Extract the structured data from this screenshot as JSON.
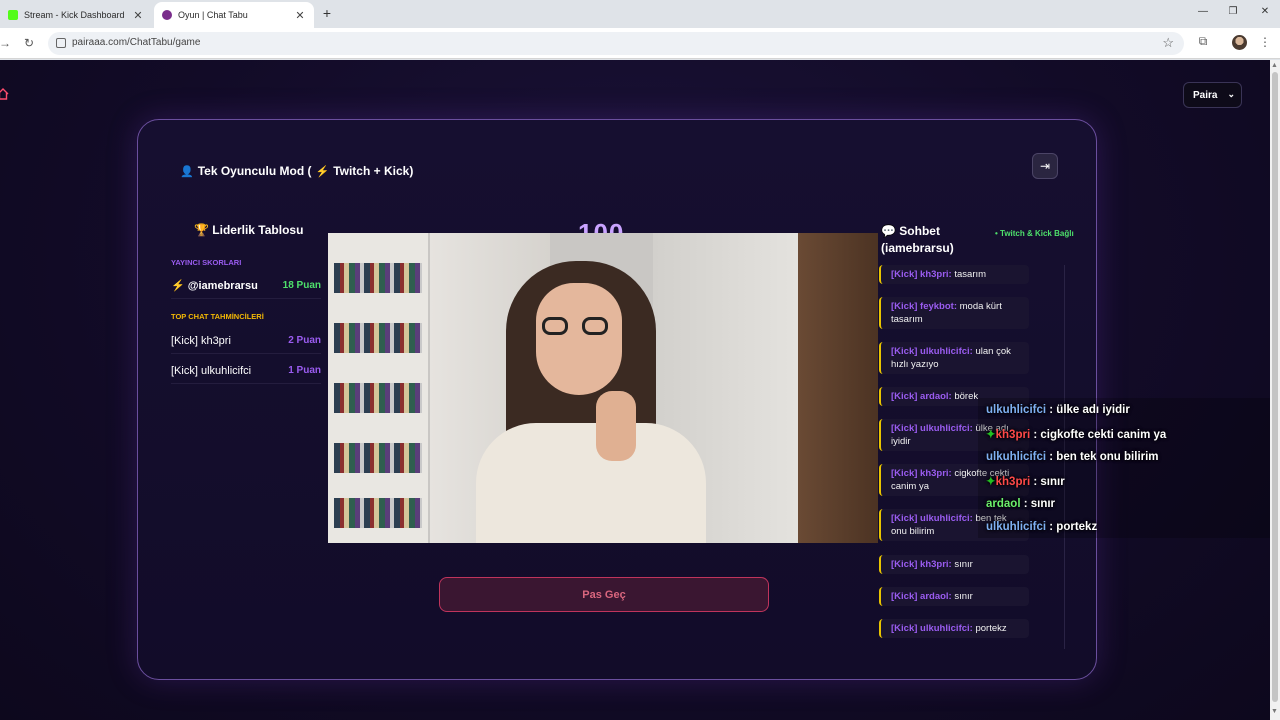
{
  "browser": {
    "tabs": [
      {
        "title": "Stream - Kick Dashboard",
        "favicon_color": "#53fc18"
      },
      {
        "title": "Oyun | Chat Tabu",
        "favicon_color": "#7a2d8c"
      }
    ],
    "url": "pairaaa.com/ChatTabu/game"
  },
  "header": {
    "language_selected": "Paira"
  },
  "game": {
    "mode_title": "Tek Oyunculu Mod (",
    "mode_platforms": "Twitch + Kick)",
    "big_number": "100",
    "skip_label": "Pas Geç"
  },
  "leaderboard": {
    "title": "Liderlik Tablosu",
    "streamer_section": "YAYINCI SKORLARI",
    "streamer": {
      "name": "@iamebrarsu",
      "points": "18 Puan"
    },
    "chat_section": "TOP CHAT TAHMİNCİLERİ",
    "chat_players": [
      {
        "name": "[Kick] kh3pri",
        "points": "2 Puan"
      },
      {
        "name": "[Kick] ulkuhlicifci",
        "points": "1 Puan"
      }
    ]
  },
  "chat": {
    "title": "Sohbet (iamebrarsu)",
    "status": "• Twitch & Kick Bağlı",
    "messages": [
      {
        "user": "[Kick] kh3pri:",
        "text": "tasarım"
      },
      {
        "user": "[Kick] feykbot:",
        "text": "moda kürt tasarım"
      },
      {
        "user": "[Kick] ulkuhlicifci:",
        "text": "ulan çok hızlı yazıyo"
      },
      {
        "user": "[Kick] ardaol:",
        "text": "börek"
      },
      {
        "user": "[Kick] ulkuhlicifci:",
        "text": "ülke adı iyidir"
      },
      {
        "user": "[Kick] kh3pri:",
        "text": "cigkofte cekti canim ya"
      },
      {
        "user": "[Kick] ulkuhlicifci:",
        "text": "ben tek onu bilirim"
      },
      {
        "user": "[Kick] kh3pri:",
        "text": "sınır"
      },
      {
        "user": "[Kick] ardaol:",
        "text": "sınır"
      },
      {
        "user": "[Kick] ulkuhlicifci:",
        "text": "portekz"
      }
    ]
  },
  "stream_overlay": [
    {
      "user": "ulkuhlicifci",
      "color": "blue",
      "badge": false,
      "text": ": ülke adı iyidir"
    },
    {
      "user": "kh3pri",
      "color": "red",
      "badge": true,
      "text": ": cigkofte cekti canim ya"
    },
    {
      "user": "ulkuhlicifci",
      "color": "blue",
      "badge": false,
      "text": ": ben tek onu bilirim"
    },
    {
      "user": "kh3pri",
      "color": "red",
      "badge": true,
      "text": ": sınır"
    },
    {
      "user": "ardaol",
      "color": "green",
      "badge": false,
      "text": ": sınır"
    },
    {
      "user": "ulkuhlicifci",
      "color": "blue",
      "badge": false,
      "text": ": portekz"
    }
  ],
  "colors": {
    "accent_purple": "#9a5cf0",
    "points_green": "#4ee06b",
    "skip_red": "#c0345c",
    "chat_border": "#e8c400"
  }
}
